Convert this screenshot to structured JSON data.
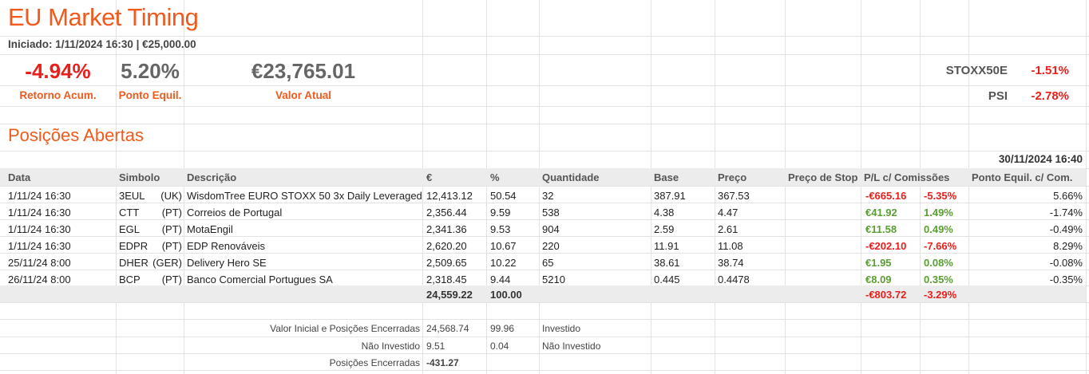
{
  "header": {
    "title": "EU Market Timing",
    "subtitle": "Iniciado: 1/11/2024 16:30 | €25,000.00"
  },
  "kpis": {
    "retorno": {
      "value": "-4.94%",
      "label": "Retorno Acum."
    },
    "ponto": {
      "value": "5.20%",
      "label": "Ponto Equil."
    },
    "valor": {
      "value": "€23,765.01",
      "label": "Valor Atual"
    }
  },
  "indices": [
    {
      "name": "STOXX50E",
      "value": "-1.51%"
    },
    {
      "name": "PSI",
      "value": "-2.78%"
    }
  ],
  "positions": {
    "section_title": "Posições Abertas",
    "timestamp": "30/11/2024 16:40",
    "columns": [
      "Data",
      "Simbolo",
      "Descrição",
      "€",
      "%",
      "Quantidade",
      "Base",
      "Preço",
      "Preço de Stop",
      "P/L c/ Comissões",
      "Ponto Equil. c/ Com."
    ],
    "rows": [
      {
        "data": "1/11/24 16:30",
        "symbol": "3EUL",
        "country": "(UK)",
        "desc": "WisdomTree EURO STOXX 50 3x Daily Leveraged",
        "eur": "12,413.12",
        "pct": "50.54",
        "qty": "32",
        "base": "387.91",
        "price": "367.53",
        "stop": "",
        "pl": "-€665.16",
        "pl_pct": "-5.35%",
        "be": "5.66%"
      },
      {
        "data": "1/11/24 16:30",
        "symbol": "CTT",
        "country": "(PT)",
        "desc": "Correios de Portugal",
        "eur": "2,356.44",
        "pct": "9.59",
        "qty": "538",
        "base": "4.38",
        "price": "4.47",
        "stop": "",
        "pl": "€41.92",
        "pl_pct": "1.49%",
        "be": "-1.74%"
      },
      {
        "data": "1/11/24 16:30",
        "symbol": "EGL",
        "country": "(PT)",
        "desc": "MotaEngil",
        "eur": "2,341.36",
        "pct": "9.53",
        "qty": "904",
        "base": "2.59",
        "price": "2.61",
        "stop": "",
        "pl": "€11.58",
        "pl_pct": "0.49%",
        "be": "-0.49%"
      },
      {
        "data": "1/11/24 16:30",
        "symbol": "EDPR",
        "country": "(PT)",
        "desc": "EDP Renováveis",
        "eur": "2,620.20",
        "pct": "10.67",
        "qty": "220",
        "base": "11.91",
        "price": "11.08",
        "stop": "",
        "pl": "-€202.10",
        "pl_pct": "-7.66%",
        "be": "8.29%"
      },
      {
        "data": "25/11/24 8:00",
        "symbol": "DHER",
        "country": "(GER)",
        "desc": "Delivery Hero SE",
        "eur": "2,509.65",
        "pct": "10.22",
        "qty": "65",
        "base": "38.61",
        "price": "38.74",
        "stop": "",
        "pl": "€1.95",
        "pl_pct": "0.08%",
        "be": "-0.08%"
      },
      {
        "data": "26/11/24 8:00",
        "symbol": "BCP",
        "country": "(PT)",
        "desc": "Banco Comercial Portugues SA",
        "eur": "2,318.45",
        "pct": "9.44",
        "qty": "5210",
        "base": "0.445",
        "price": "0.4478",
        "stop": "",
        "pl": "€8.09",
        "pl_pct": "0.35%",
        "be": "-0.35%"
      }
    ],
    "totals": {
      "eur": "24,559.22",
      "pct": "100.00",
      "pl": "-€803.72",
      "pl_pct": "-3.29%"
    }
  },
  "summary": [
    {
      "label": "Valor Inicial e Posições Encerradas",
      "value": "24,568.74",
      "pct": "99.96",
      "note": "Investido"
    },
    {
      "label": "Não Investido",
      "value": "9.51",
      "pct": "0.04",
      "note": "Não Investido"
    },
    {
      "label": "Posições Encerradas",
      "value": "-431.27",
      "pct": "",
      "note": ""
    }
  ]
}
